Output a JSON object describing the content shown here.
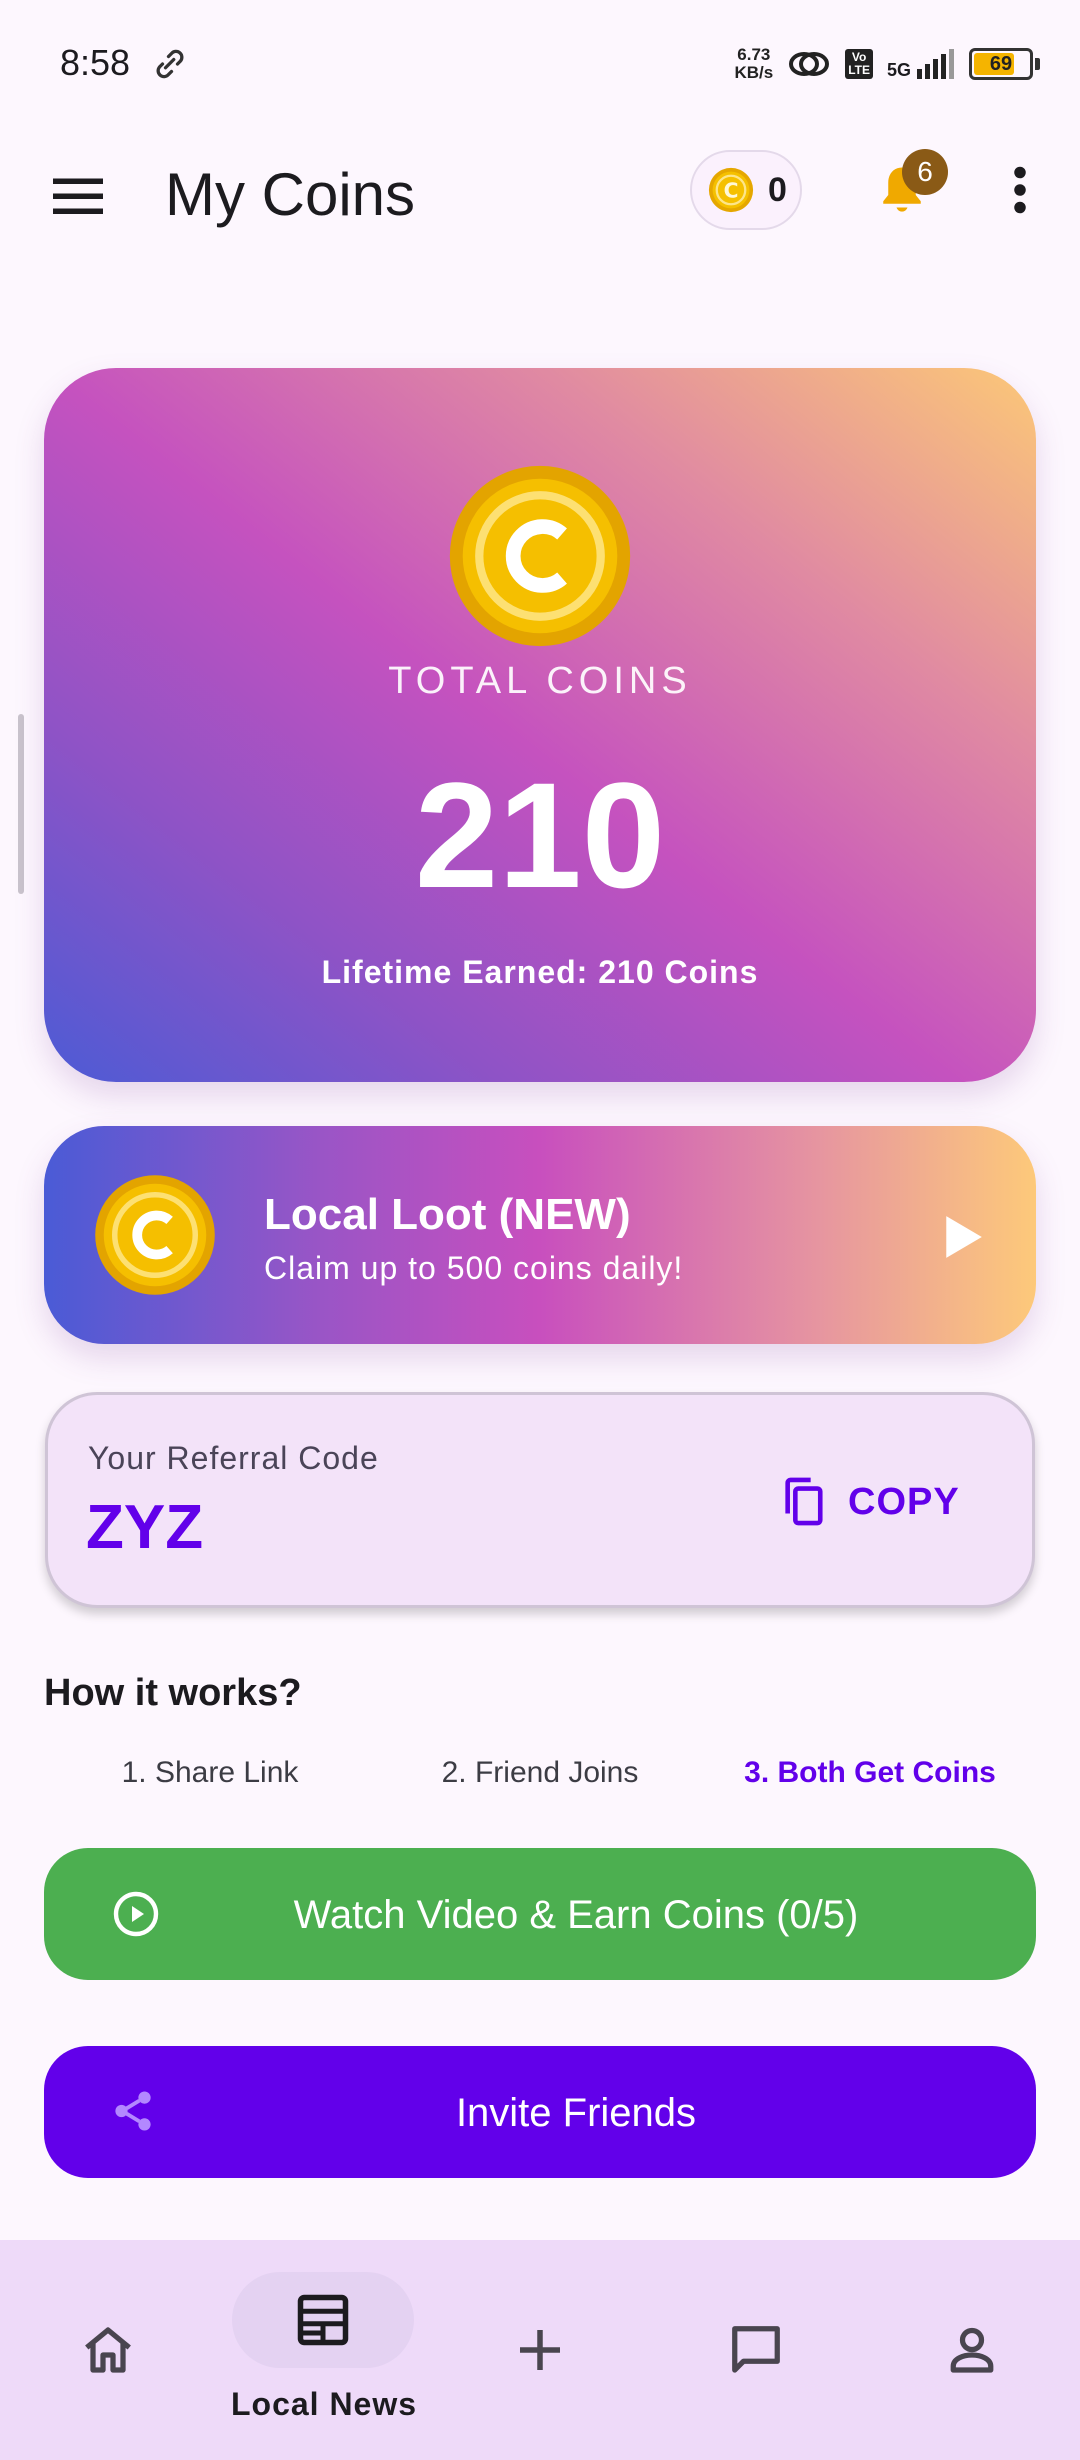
{
  "status_bar": {
    "time": "8:58",
    "net_speed_value": "6.73",
    "net_speed_unit": "KB/s",
    "volte_top": "Vo",
    "volte_bottom": "LTE",
    "network": "5G",
    "battery_level": "69",
    "battery_fraction": 0.69
  },
  "app_bar": {
    "title": "My Coins",
    "coin_count": "0",
    "notification_count": "6"
  },
  "total_card": {
    "label": "TOTAL COINS",
    "value": "210",
    "lifetime": "Lifetime Earned: 210 Coins"
  },
  "loot_card": {
    "title": "Local Loot (NEW)",
    "subtitle": "Claim up to 500 coins daily!"
  },
  "referral": {
    "label": "Your Referral Code",
    "code": "ZYZ",
    "copy_label": "COPY"
  },
  "how_it_works": {
    "title": "How it works?",
    "steps": [
      "1. Share Link",
      "2. Friend Joins",
      "3. Both Get Coins"
    ]
  },
  "buttons": {
    "watch_video": "Watch Video & Earn Coins (0/5)",
    "invite": "Invite Friends"
  },
  "bottom_nav": {
    "active_label": "Local News"
  },
  "colors": {
    "accent_purple": "#6200ea",
    "watch_green": "#4caf50",
    "coin_gold": "#f5b800",
    "nav_background": "#eedaf9"
  },
  "icons": {
    "menu": "menu-icon",
    "bell": "bell-icon",
    "more": "more-vert-icon",
    "coin": "coin-icon",
    "play": "play-arrow-icon",
    "copy": "copy-icon",
    "play_circle": "play-circle-icon",
    "share": "share-icon",
    "home": "home-icon",
    "news": "news-icon",
    "add": "add-icon",
    "chat": "chat-icon",
    "profile": "profile-icon"
  }
}
